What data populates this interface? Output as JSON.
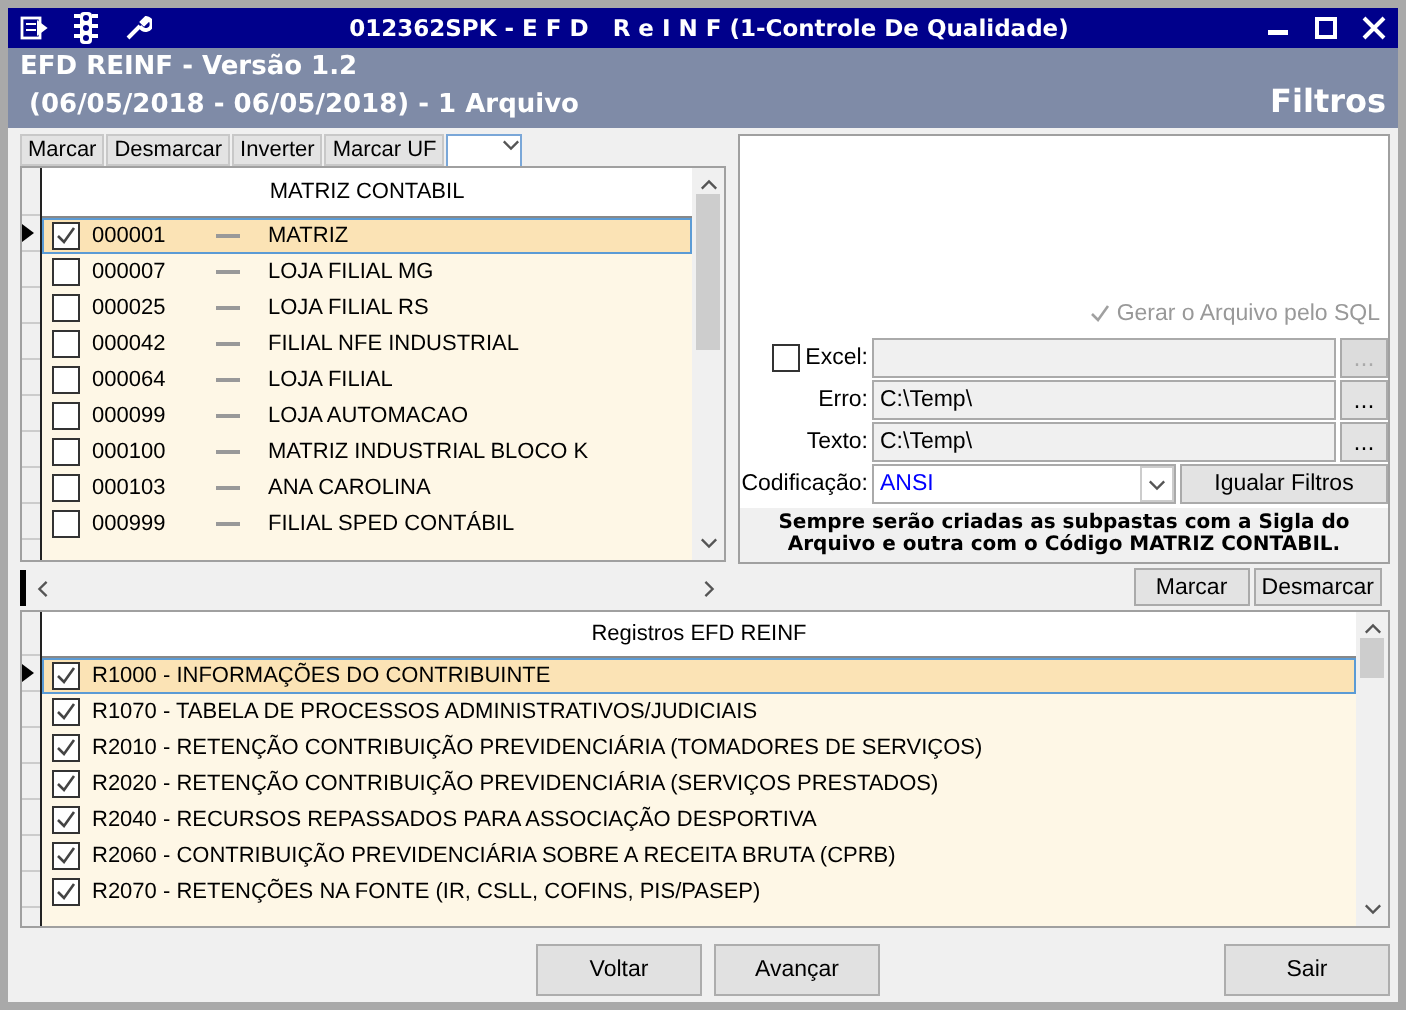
{
  "window": {
    "title": "012362SPK - E F D   R e I N F (1-Controle De Qualidade)"
  },
  "header": {
    "title": "EFD REINF - Versão 1.2",
    "period": "(06/05/2018 - 06/05/2018) - 1 Arquivo",
    "section": "Filtros"
  },
  "company_toolbar": [
    "Marcar",
    "Desmarcar",
    "Inverter",
    "Marcar UF"
  ],
  "company_grid": {
    "column": "MATRIZ CONTABIL",
    "rows": [
      {
        "code": "000001",
        "name": "MATRIZ",
        "checked": true,
        "selected": true
      },
      {
        "code": "000007",
        "name": "LOJA FILIAL MG",
        "checked": false,
        "selected": false
      },
      {
        "code": "000025",
        "name": "LOJA FILIAL RS",
        "checked": false,
        "selected": false
      },
      {
        "code": "000042",
        "name": "FILIAL NFE INDUSTRIAL",
        "checked": false,
        "selected": false
      },
      {
        "code": "000064",
        "name": "LOJA FILIAL",
        "checked": false,
        "selected": false
      },
      {
        "code": "000099",
        "name": "LOJA AUTOMACAO",
        "checked": false,
        "selected": false
      },
      {
        "code": "000100",
        "name": "MATRIZ INDUSTRIAL BLOCO K",
        "checked": false,
        "selected": false
      },
      {
        "code": "000103",
        "name": "ANA CAROLINA",
        "checked": false,
        "selected": false
      },
      {
        "code": "000999",
        "name": "FILIAL SPED CONTÁBIL",
        "checked": false,
        "selected": false
      }
    ]
  },
  "options": {
    "sql": {
      "label": "Gerar o Arquivo pelo SQL",
      "checked": true,
      "disabled": true
    },
    "fields": [
      {
        "label": "Excel:",
        "kind": "checkbox",
        "checked": false,
        "disabled": true,
        "button": "..."
      },
      {
        "label": "Erro:",
        "value": "C:\\Temp\\",
        "kind": "plain",
        "disabled": false,
        "button": "..."
      },
      {
        "label": "Texto:",
        "value": "C:\\Temp\\",
        "kind": "plain",
        "disabled": false,
        "button": "..."
      }
    ],
    "encoding": {
      "label": "Codificação:",
      "value": "ANSI"
    },
    "equalize_button": "Igualar Filtros",
    "note": "Sempre serão criadas as subpastas com a Sigla do Arquivo e outra com o Código MATRIZ CONTABIL."
  },
  "record_buttons": [
    "Marcar",
    "Desmarcar"
  ],
  "records_grid": {
    "column": "Registros EFD REINF",
    "rows": [
      {
        "label": "R1000 - INFORMAÇÕES DO CONTRIBUINTE",
        "checked": true,
        "selected": true
      },
      {
        "label": "R1070 - TABELA DE PROCESSOS ADMINISTRATIVOS/JUDICIAIS",
        "checked": true,
        "selected": false
      },
      {
        "label": "R2010 - RETENÇÃO CONTRIBUIÇÃO PREVIDENCIÁRIA (TOMADORES DE SERVIÇOS)",
        "checked": true,
        "selected": false
      },
      {
        "label": "R2020 - RETENÇÃO CONTRIBUIÇÃO PREVIDENCIÁRIA (SERVIÇOS PRESTADOS)",
        "checked": true,
        "selected": false
      },
      {
        "label": "R2040 - RECURSOS REPASSADOS PARA ASSOCIAÇÃO DESPORTIVA",
        "checked": true,
        "selected": false
      },
      {
        "label": "R2060 - CONTRIBUIÇÃO PREVIDENCIÁRIA SOBRE A RECEITA BRUTA (CPRB)",
        "checked": true,
        "selected": false
      },
      {
        "label": "R2070 - RETENÇÕES NA FONTE (IR, CSLL, COFINS, PIS/PASEP)",
        "checked": true,
        "selected": false
      }
    ]
  },
  "footer_buttons": [
    {
      "label": "Voltar",
      "kind": "nav"
    },
    {
      "label": "Avançar",
      "kind": "nav"
    },
    {
      "label": "Sair",
      "kind": "exit"
    }
  ]
}
